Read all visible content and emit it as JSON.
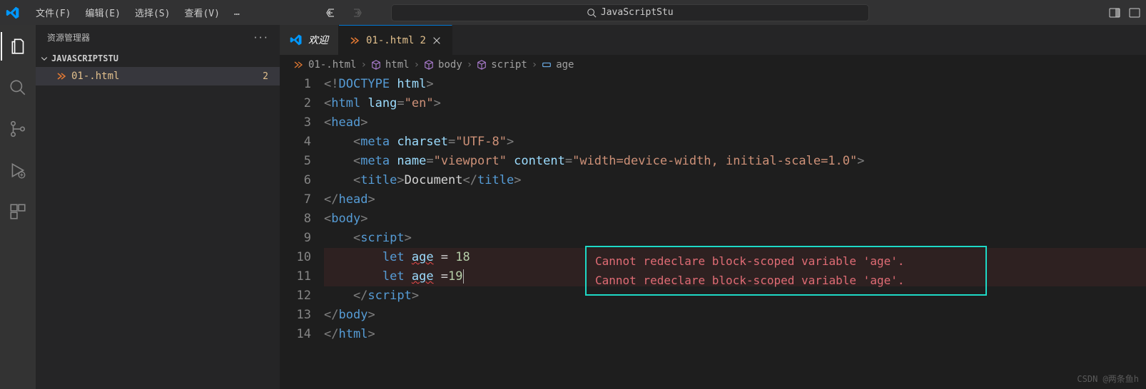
{
  "titlebar": {
    "menu": [
      "文件(F)",
      "编辑(E)",
      "选择(S)",
      "查看(V)",
      "…"
    ],
    "search_text": "JavaScriptStu"
  },
  "sidebar": {
    "title": "资源管理器",
    "section": "JAVASCRIPTSTU",
    "file": {
      "name": "01-.html",
      "badge": "2"
    }
  },
  "tabs": {
    "welcome": "欢迎",
    "active": {
      "name": "01-.html",
      "badge": "2"
    }
  },
  "breadcrumbs": [
    "01-.html",
    "html",
    "body",
    "script",
    "age"
  ],
  "code": {
    "lines": [
      {
        "n": 1,
        "seg": [
          [
            "<!",
            "punct"
          ],
          [
            "DOCTYPE ",
            "doctype"
          ],
          [
            "html",
            "attr"
          ],
          [
            ">",
            "punct"
          ]
        ]
      },
      {
        "n": 2,
        "seg": [
          [
            "<",
            "punct"
          ],
          [
            "html ",
            "tag"
          ],
          [
            "lang",
            "attr"
          ],
          [
            "=",
            "punct"
          ],
          [
            "\"en\"",
            "str"
          ],
          [
            ">",
            "punct"
          ]
        ]
      },
      {
        "n": 3,
        "seg": [
          [
            "<",
            "punct"
          ],
          [
            "head",
            "tag"
          ],
          [
            ">",
            "punct"
          ]
        ]
      },
      {
        "n": 4,
        "seg": [
          [
            "    <",
            "punct"
          ],
          [
            "meta ",
            "tag"
          ],
          [
            "charset",
            "attr"
          ],
          [
            "=",
            "punct"
          ],
          [
            "\"UTF-8\"",
            "str"
          ],
          [
            ">",
            "punct"
          ]
        ]
      },
      {
        "n": 5,
        "seg": [
          [
            "    <",
            "punct"
          ],
          [
            "meta ",
            "tag"
          ],
          [
            "name",
            "attr"
          ],
          [
            "=",
            "punct"
          ],
          [
            "\"viewport\" ",
            "str"
          ],
          [
            "content",
            "attr"
          ],
          [
            "=",
            "punct"
          ],
          [
            "\"width=device-width, initial-scale=1.0\"",
            "str"
          ],
          [
            ">",
            "punct"
          ]
        ]
      },
      {
        "n": 6,
        "seg": [
          [
            "    <",
            "punct"
          ],
          [
            "title",
            "tag"
          ],
          [
            ">",
            "punct"
          ],
          [
            "Document",
            "txt"
          ],
          [
            "</",
            "punct"
          ],
          [
            "title",
            "tag"
          ],
          [
            ">",
            "punct"
          ]
        ]
      },
      {
        "n": 7,
        "seg": [
          [
            "</",
            "punct"
          ],
          [
            "head",
            "tag"
          ],
          [
            ">",
            "punct"
          ]
        ]
      },
      {
        "n": 8,
        "seg": [
          [
            "<",
            "punct"
          ],
          [
            "body",
            "tag"
          ],
          [
            ">",
            "punct"
          ]
        ]
      },
      {
        "n": 9,
        "seg": [
          [
            "    <",
            "punct"
          ],
          [
            "script",
            "tag"
          ],
          [
            ">",
            "punct"
          ]
        ]
      },
      {
        "n": 10,
        "err": true,
        "seg": [
          [
            "        ",
            "txt"
          ],
          [
            "let ",
            "kw"
          ],
          [
            "age",
            "var",
            true
          ],
          [
            " = ",
            "txt"
          ],
          [
            "18",
            "num"
          ]
        ]
      },
      {
        "n": 11,
        "err": true,
        "seg": [
          [
            "        ",
            "txt"
          ],
          [
            "let ",
            "kw"
          ],
          [
            "age",
            "var",
            true
          ],
          [
            " =",
            "txt"
          ],
          [
            "19",
            "num"
          ]
        ],
        "caret": true
      },
      {
        "n": 12,
        "seg": [
          [
            "    </",
            "punct"
          ],
          [
            "script",
            "tag"
          ],
          [
            ">",
            "punct"
          ]
        ]
      },
      {
        "n": 13,
        "seg": [
          [
            "</",
            "punct"
          ],
          [
            "body",
            "tag"
          ],
          [
            ">",
            "punct"
          ]
        ]
      },
      {
        "n": 14,
        "seg": [
          [
            "</",
            "punct"
          ],
          [
            "html",
            "tag"
          ],
          [
            ">",
            "punct"
          ]
        ]
      }
    ]
  },
  "annotation": [
    "Cannot redeclare block-scoped variable 'age'.",
    "Cannot redeclare block-scoped variable 'age'."
  ],
  "watermark": "CSDN @两条鱼h"
}
